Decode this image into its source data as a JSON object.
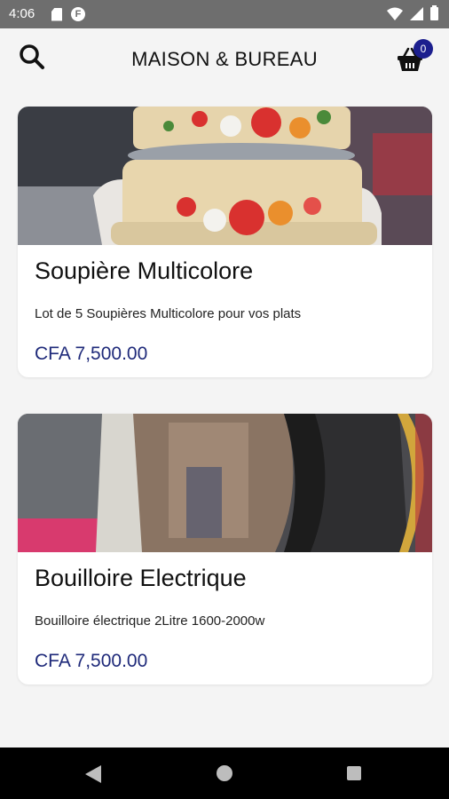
{
  "status_bar": {
    "time": "4:06",
    "icons": [
      "sd-card-icon",
      "app-notification-icon",
      "wifi-icon",
      "signal-icon",
      "battery-icon"
    ],
    "notification_glyph": "F"
  },
  "header": {
    "title": "MAISON & BUREAU",
    "cart_count": "0",
    "search_icon": "search-icon",
    "cart_icon": "basket-icon"
  },
  "products": [
    {
      "title": "Soupière Multicolore",
      "description": "Lot de 5 Soupières Multicolore pour vos plats",
      "price": "CFA 7,500.00"
    },
    {
      "title": "Bouilloire Electrique",
      "description": "Bouilloire électrique 2Litre 1600-2000w",
      "price": "CFA 7,500.00"
    }
  ],
  "nav_bar": {
    "icons": [
      "back-icon",
      "home-icon",
      "recents-icon"
    ]
  },
  "colors": {
    "accent": "#1c1f8e",
    "price": "#1f2a7a",
    "status_bar": "#6e6e6e",
    "background": "#f4f4f4"
  }
}
